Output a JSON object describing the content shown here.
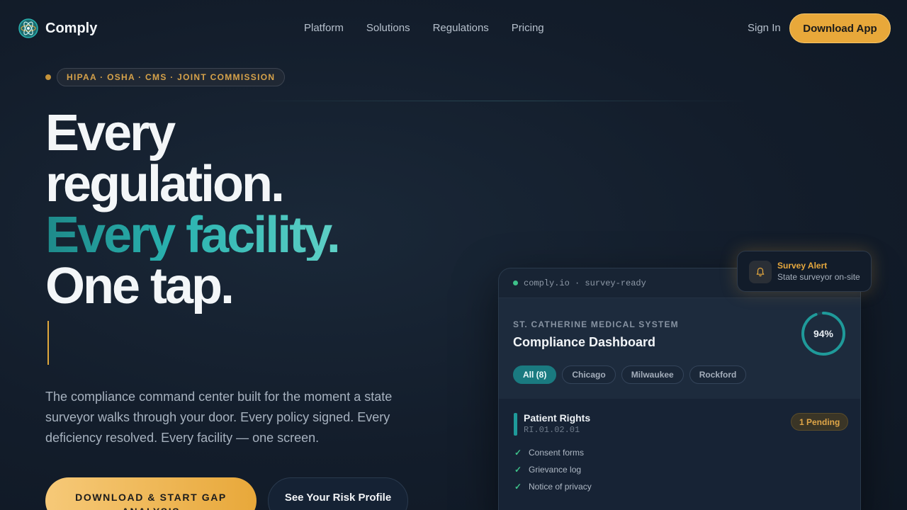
{
  "brand": {
    "name": "Comply",
    "icon": "atom-logo-icon"
  },
  "nav": {
    "links": [
      "Platform",
      "Solutions",
      "Regulations",
      "Pricing"
    ],
    "sign_in": "Sign In",
    "download": "Download App"
  },
  "hero": {
    "tag": "HIPAA · OSHA · CMS · JOINT COMMISSION",
    "headline": [
      "Every",
      "regulation.",
      "Every facility.",
      "One tap."
    ],
    "subtext": "The compliance command center built for the moment a state surveyor walks through your door. Every policy signed. Every deficiency resolved. Every facility — one screen.",
    "cta_primary": "DOWNLOAD & START GAP ANALYSIS",
    "cta_secondary": "See Your Risk Profile"
  },
  "card": {
    "url": "comply.io · survey-ready",
    "org": "ST. CATHERINE MEDICAL SYSTEM",
    "title": "Compliance Dashboard",
    "score": "94%",
    "score_fraction": 0.94,
    "chips": [
      "All (8)",
      "Chicago",
      "Milwaukee",
      "Rockford"
    ],
    "section": {
      "title": "Patient Rights",
      "code": "RI.01.02.01",
      "badge": "1 Pending",
      "items": [
        "Consent forms",
        "Grievance log",
        "Notice of privacy"
      ]
    }
  },
  "alert": {
    "title": "Survey Alert",
    "subtitle": "State surveyor on-site",
    "icon": "bell-icon"
  },
  "colors": {
    "accent": "#e8a83a",
    "teal": "#1f9a9a",
    "bg": "#131d2b"
  }
}
